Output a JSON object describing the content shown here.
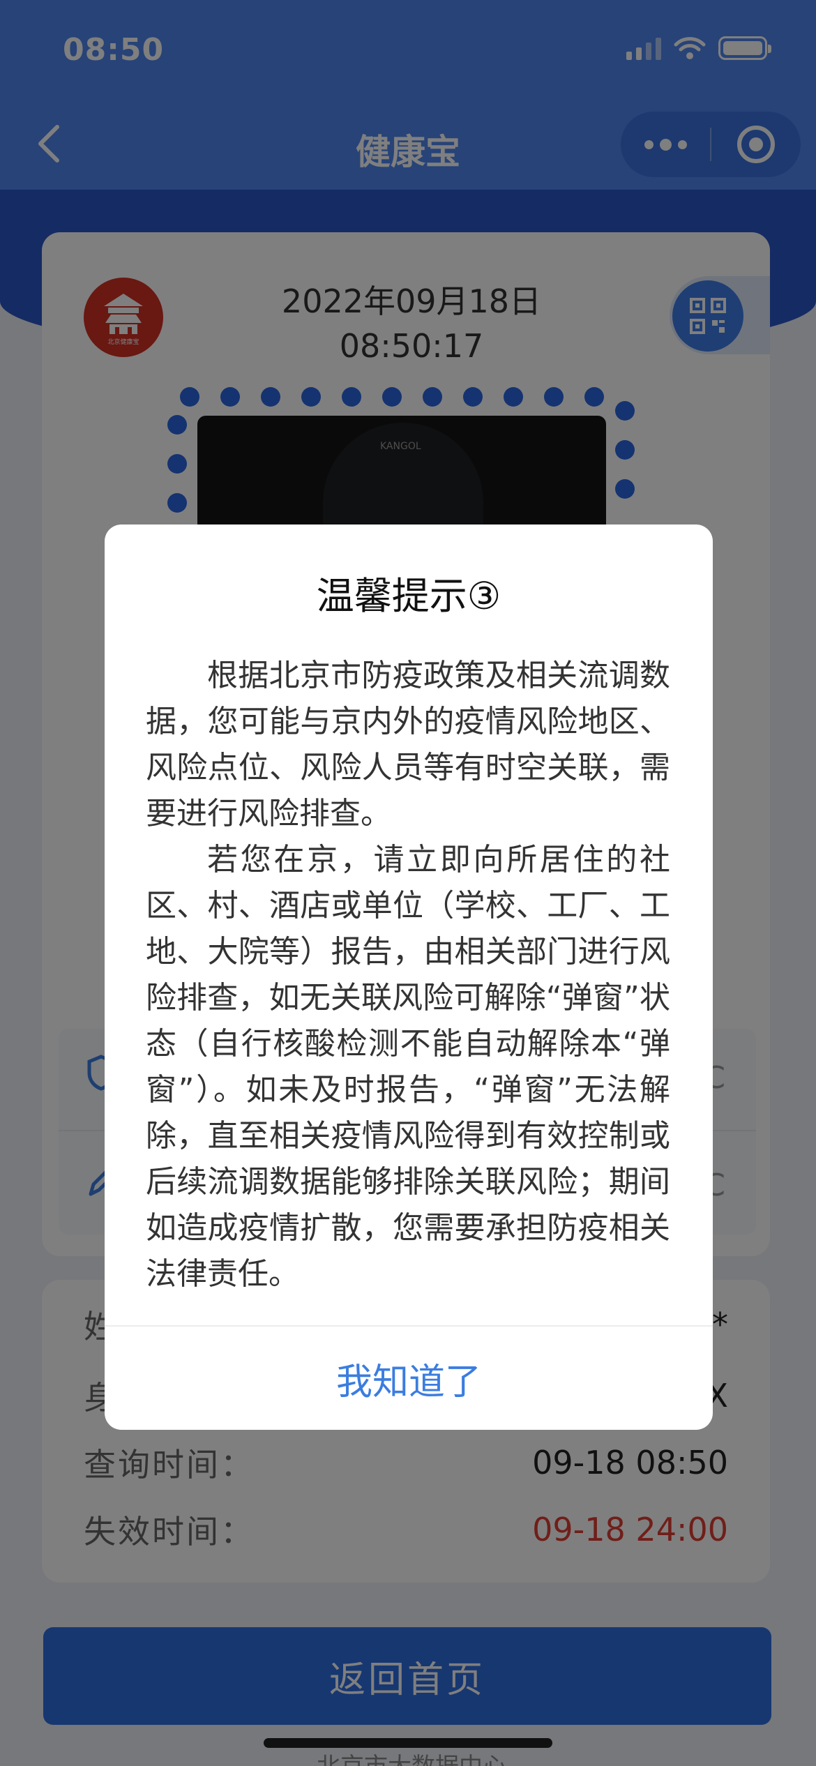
{
  "status_bar": {
    "time": "08:50"
  },
  "nav": {
    "title": "健康宝"
  },
  "card": {
    "date": "2022年09月18日",
    "time": "08:50:17",
    "logo_text": "北京健康宝",
    "photo_brand": "KANGOL"
  },
  "rows": [
    {
      "tail": "C"
    },
    {
      "tail": "C"
    }
  ],
  "info": {
    "rows": [
      {
        "label": "姓",
        "value": "*"
      },
      {
        "label": "身",
        "value": "X"
      },
      {
        "label": "查询时间：",
        "value": "09-18 08:50"
      },
      {
        "label": "失效时间：",
        "value": "09-18 24:00"
      }
    ]
  },
  "home_button": "返回首页",
  "footer": "北京市大数据中心",
  "modal": {
    "title": "温馨提示③",
    "paragraph_1": "根据北京市防疫政策及相关流调数据，您可能与京内外的疫情风险地区、风险点位、风险人员等有时空关联，需要进行风险排查。",
    "paragraph_2": "若您在京，请立即向所居住的社区、村、酒店或单位（学校、工厂、工地、大院等）报告，由相关部门进行风险排查，如无关联风险可解除“弹窗”状态（自行核酸检测不能自动解除本“弹窗”）。如未及时报告，“弹窗”无法解除，直至相关疫情风险得到有效控制或后续流调数据能够排除关联风险；期间如造成疫情扩散，您需要承担防疫相关法律责任。",
    "button": "我知道了"
  },
  "colors": {
    "header_blue": "#4f86f0",
    "accent_blue": "#3b7de0",
    "expire_red": "#e13c32"
  }
}
